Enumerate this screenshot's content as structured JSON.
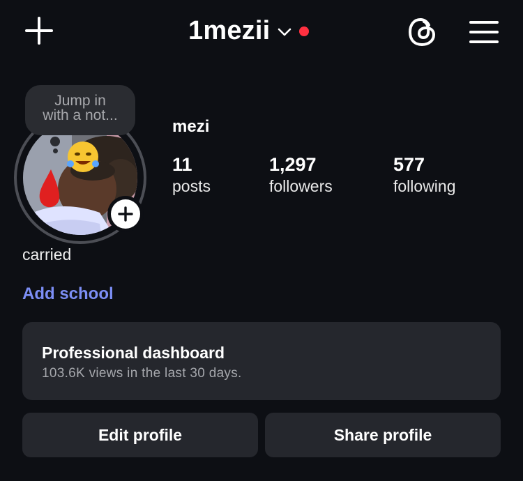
{
  "header": {
    "username": "1mezii",
    "icons": {
      "create": "plus-icon",
      "switch_account": "chevron-down-icon",
      "notification_dot": "red-dot",
      "threads": "threads-icon",
      "menu": "hamburger-menu-icon"
    }
  },
  "note": {
    "prompt_line1": "Jump in",
    "prompt_line2": "with a not..."
  },
  "profile": {
    "display_name": "mezi",
    "bio": "carried",
    "add_school_label": "Add school"
  },
  "stats": [
    {
      "value": "11",
      "label": "posts"
    },
    {
      "value": "1,297",
      "label": "followers"
    },
    {
      "value": "577",
      "label": "following"
    }
  ],
  "dashboard": {
    "title": "Professional dashboard",
    "subtitle": "103.6K views in the last 30 days."
  },
  "actions": {
    "edit_label": "Edit profile",
    "share_label": "Share profile"
  },
  "colors": {
    "background": "#0d0f14",
    "card": "#25272d",
    "link": "#7c8ef5",
    "notification": "#ff3040"
  }
}
